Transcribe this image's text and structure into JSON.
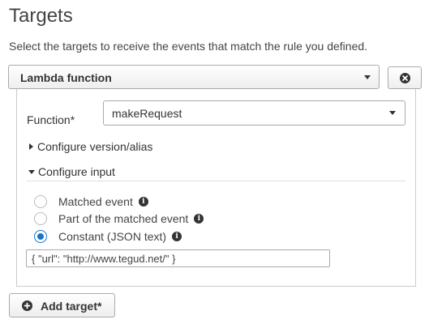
{
  "header": {
    "title": "Targets",
    "subtitle": "Select the targets to receive the events that match the rule you defined."
  },
  "target": {
    "type_selected": "Lambda function",
    "remove_icon": "remove-circle-icon"
  },
  "function": {
    "label": "Function*",
    "value": "makeRequest"
  },
  "sections": {
    "configure_version": "Configure version/alias",
    "configure_input": "Configure input"
  },
  "input_options": [
    {
      "label": "Matched event",
      "checked": false
    },
    {
      "label": "Part of the matched event",
      "checked": false
    },
    {
      "label": "Constant (JSON text)",
      "checked": true
    }
  ],
  "json_input": {
    "value": "{ \"url\": \"http://www.tegud.net/\" }"
  },
  "add_target": {
    "label": "Add target*",
    "icon": "plus-circle-icon"
  },
  "colors": {
    "accent": "#1a73c8",
    "border": "#aaaaaa"
  }
}
